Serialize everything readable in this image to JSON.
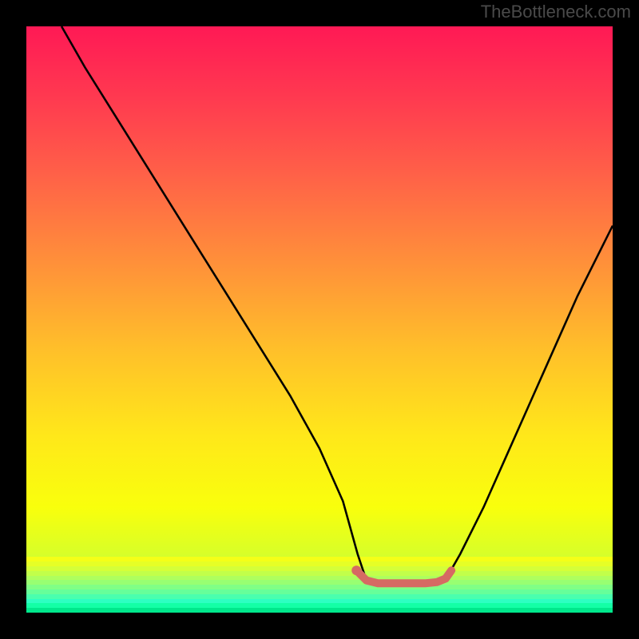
{
  "watermark": "TheBottleneck.com",
  "gradient": {
    "stops": [
      {
        "pos": 0.0,
        "color": "#ff1955"
      },
      {
        "pos": 0.12,
        "color": "#ff3950"
      },
      {
        "pos": 0.25,
        "color": "#ff6048"
      },
      {
        "pos": 0.4,
        "color": "#ff8f3a"
      },
      {
        "pos": 0.55,
        "color": "#ffbf2a"
      },
      {
        "pos": 0.7,
        "color": "#ffe81a"
      },
      {
        "pos": 0.82,
        "color": "#f9ff0c"
      },
      {
        "pos": 0.9,
        "color": "#d8ff28"
      },
      {
        "pos": 0.95,
        "color": "#a8ff58"
      },
      {
        "pos": 1.0,
        "color": "#5aff8a"
      }
    ]
  },
  "green_band": {
    "top_pct": 90.5,
    "stripes": [
      "#f4ff18",
      "#e6ff26",
      "#d5ff38",
      "#c2ff4a",
      "#aeff5e",
      "#98ff72",
      "#80ff86",
      "#66ff9a",
      "#4affae",
      "#2effc2",
      "#14ffa6",
      "#00e88c"
    ]
  },
  "chart_data": {
    "type": "line",
    "title": "",
    "xlabel": "",
    "ylabel": "",
    "xlim": [
      0,
      100
    ],
    "ylim": [
      0,
      100
    ],
    "series": [
      {
        "name": "curve",
        "color": "#000000",
        "x": [
          6,
          10,
          15,
          20,
          25,
          30,
          35,
          40,
          45,
          50,
          54,
          56.5,
          58,
          61,
          64,
          67,
          70,
          72,
          74,
          78,
          82,
          86,
          90,
          94,
          98,
          100
        ],
        "y": [
          100,
          93,
          85,
          77,
          69,
          61,
          53,
          45,
          37,
          28,
          19,
          10,
          5.5,
          5.0,
          5.0,
          5.0,
          5.2,
          6.5,
          10,
          18,
          27,
          36,
          45,
          54,
          62,
          66
        ]
      },
      {
        "name": "highlight",
        "color": "#d66a63",
        "stroke_width": 10,
        "x": [
          56.5,
          58,
          60,
          62,
          64,
          66,
          68,
          70,
          71.5,
          72.5
        ],
        "y": [
          7.0,
          5.5,
          5.0,
          5.0,
          5.0,
          5.0,
          5.0,
          5.2,
          5.8,
          7.2
        ]
      }
    ],
    "markers": [
      {
        "x": 56.3,
        "y": 7.2,
        "r": 6,
        "color": "#d66a63"
      }
    ]
  }
}
